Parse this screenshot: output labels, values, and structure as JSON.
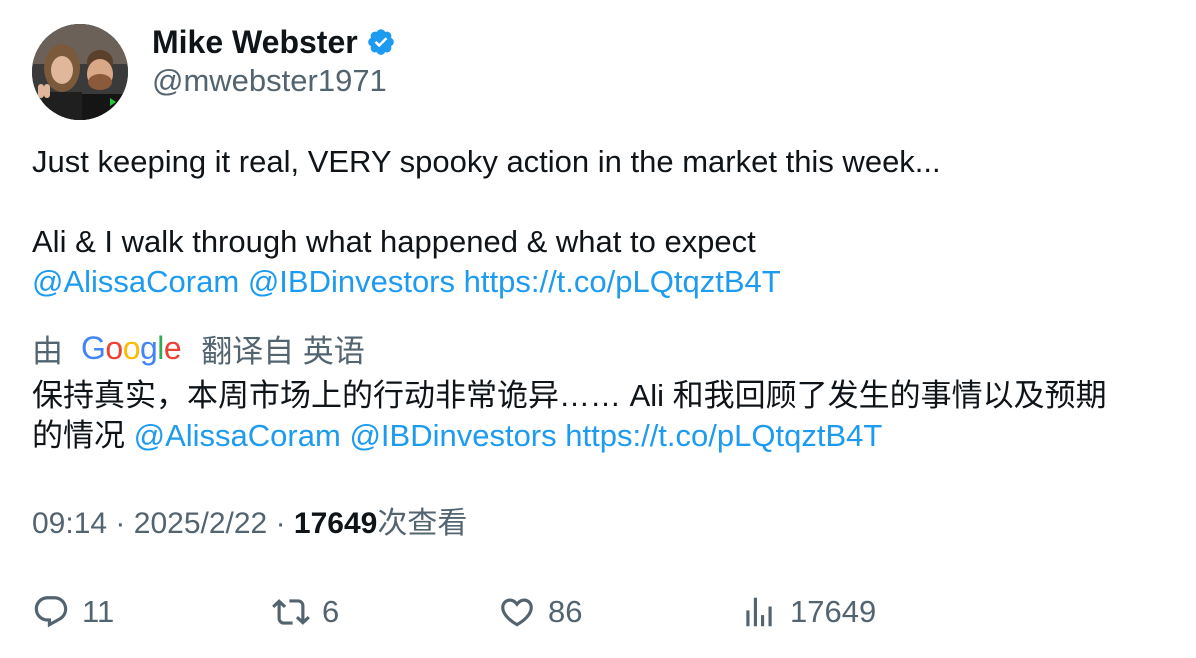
{
  "author": {
    "name": "Mike Webster",
    "handle": "@mwebster1971",
    "verified": true,
    "avatar": "avatar-photo"
  },
  "tweet": {
    "line1": "Just keeping it real, VERY spooky action in the market this week...",
    "line2": "Ali & I walk through what happened & what to expect",
    "mention1": "@AlissaCoram",
    "mention2": "@IBDinvestors",
    "url": "https://t.co/pLQtqztB4T"
  },
  "translation": {
    "prefix": "由",
    "google": [
      "G",
      "o",
      "o",
      "g",
      "l",
      "e"
    ],
    "google_colors": [
      "#4285f4",
      "#ea4335",
      "#fbbc05",
      "#4285f4",
      "#34a853",
      "#ea4335"
    ],
    "suffix": "翻译自 英语",
    "line1": "保持真实，本周市场上的行动非常诡异…… Ali 和我回顾了发生的事情以及预期",
    "line2_prefix": "的情况",
    "mention1": "@AlissaCoram",
    "mention2": "@IBDinvestors",
    "url": "https://t.co/pLQtqztB4T"
  },
  "meta": {
    "time": "09:14",
    "separator": "·",
    "date": "2025/2/22",
    "views_count": "17649",
    "views_label": "次查看"
  },
  "actions": {
    "replies": "11",
    "retweets": "6",
    "likes": "86",
    "views": "17649"
  },
  "colors": {
    "link": "#1d9bf0",
    "secondary": "#536471",
    "primary_text": "#0f1419",
    "verified": "#1d9bf0"
  }
}
